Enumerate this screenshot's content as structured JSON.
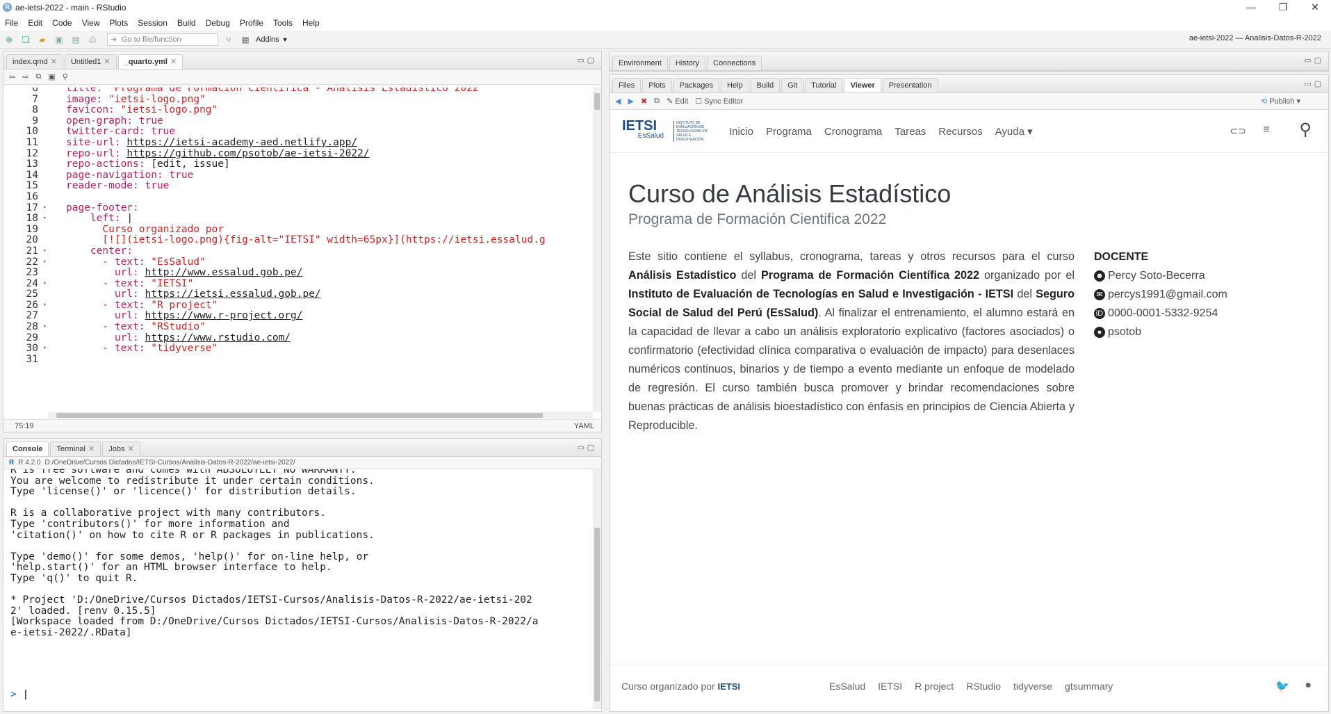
{
  "window": {
    "title": "ae-ietsi-2022 - main - RStudio",
    "app_icon": "R",
    "min": "—",
    "max": "❐",
    "close": "✕"
  },
  "menu": [
    "File",
    "Edit",
    "Code",
    "View",
    "Plots",
    "Session",
    "Build",
    "Debug",
    "Profile",
    "Tools",
    "Help"
  ],
  "toolbar": {
    "goto_placeholder": "Go to file/function",
    "addins": "Addins",
    "project": "ae-ietsi-2022 — Analisis-Datos-R-2022"
  },
  "editor": {
    "tabs": [
      {
        "label": "index.qmd",
        "active": false
      },
      {
        "label": "Untitled1",
        "active": false
      },
      {
        "label": "_quarto.yml",
        "active": true
      }
    ],
    "status_pos": "75:19",
    "status_mode": "YAML",
    "lines": [
      {
        "n": "6",
        "fold": false,
        "html": "<span class='k'>title: </span><span class='s'>\"Programa de Formación Cientifica - Análisis Estadístico 2022\"</span>"
      },
      {
        "n": "7",
        "fold": false,
        "html": "<span class='k'>image: </span><span class='s'>\"ietsi-logo.png\"</span>"
      },
      {
        "n": "8",
        "fold": false,
        "html": "<span class='k'>favicon: </span><span class='s'>\"ietsi-logo.png\"</span>"
      },
      {
        "n": "9",
        "fold": false,
        "html": "<span class='k'>open-graph: true</span>"
      },
      {
        "n": "10",
        "fold": false,
        "html": "<span class='k'>twitter-card: true</span>"
      },
      {
        "n": "11",
        "fold": false,
        "html": "<span class='k'>site-url: </span><span class='u'>https://ietsi-academy-aed.netlify.app/</span>"
      },
      {
        "n": "12",
        "fold": false,
        "html": "<span class='k'>repo-url: </span><span class='u'>https://github.com/psotob/ae-ietsi-2022/</span>"
      },
      {
        "n": "13",
        "fold": false,
        "html": "<span class='k'>repo-actions: </span><span class='p'>[edit, issue]</span>"
      },
      {
        "n": "14",
        "fold": false,
        "html": "<span class='k'>page-navigation: true</span>"
      },
      {
        "n": "15",
        "fold": false,
        "html": "<span class='k'>reader-mode: true</span>"
      },
      {
        "n": "16",
        "fold": false,
        "html": ""
      },
      {
        "n": "17",
        "fold": true,
        "html": "<span class='k'>page-footer:</span>"
      },
      {
        "n": "18",
        "fold": true,
        "html": "    <span class='k'>left: </span><span class='p'>|</span>"
      },
      {
        "n": "19",
        "fold": false,
        "html": "      <span class='st'>Curso organizado por</span>"
      },
      {
        "n": "20",
        "fold": false,
        "html": "      <span class='st'>[![](ietsi-logo.png){fig-alt=\"IETSI\" width=65px}](https://ietsi.essalud.g</span>"
      },
      {
        "n": "21",
        "fold": true,
        "html": "    <span class='k'>center:</span>"
      },
      {
        "n": "22",
        "fold": true,
        "html": "      <span class='k'>- text: </span><span class='s'>\"EsSalud\"</span>"
      },
      {
        "n": "23",
        "fold": false,
        "html": "        <span class='k'>url: </span><span class='u'>http://www.essalud.gob.pe/</span>"
      },
      {
        "n": "24",
        "fold": true,
        "html": "      <span class='k'>- text: </span><span class='s'>\"IETSI\"</span>"
      },
      {
        "n": "25",
        "fold": false,
        "html": "        <span class='k'>url: </span><span class='u'>https://ietsi.essalud.gob.pe/</span>"
      },
      {
        "n": "26",
        "fold": true,
        "html": "      <span class='k'>- text: </span><span class='s'>\"R project\"</span>"
      },
      {
        "n": "27",
        "fold": false,
        "html": "        <span class='k'>url: </span><span class='u'>https://www.r-project.org/</span>"
      },
      {
        "n": "28",
        "fold": true,
        "html": "      <span class='k'>- text: </span><span class='s'>\"RStudio\"</span>"
      },
      {
        "n": "29",
        "fold": false,
        "html": "        <span class='k'>url: </span><span class='u'>https://www.rstudio.com/</span>"
      },
      {
        "n": "30",
        "fold": true,
        "html": "      <span class='k'>- text: </span><span class='s'>\"tidyverse\"</span>"
      },
      {
        "n": "31",
        "fold": false,
        "html": ""
      }
    ]
  },
  "console": {
    "tabs": [
      {
        "label": "Console",
        "active": true
      },
      {
        "label": "Terminal",
        "active": false
      },
      {
        "label": "Jobs",
        "active": false
      }
    ],
    "r_version": "R 4.2.0",
    "path": "D:/OneDrive/Cursos Dictados/IETSI-Cursos/Analisis-Datos-R-2022/ae-ietsi-2022/",
    "output": "R is free software and comes with ABSOLUTELY NO WARRANTY.\nYou are welcome to redistribute it under certain conditions.\nType 'license()' or 'licence()' for distribution details.\n\nR is a collaborative project with many contributors.\nType 'contributors()' for more information and\n'citation()' on how to cite R or R packages in publications.\n\nType 'demo()' for some demos, 'help()' for on-line help, or\n'help.start()' for an HTML browser interface to help.\nType 'q()' to quit R.\n\n* Project 'D:/OneDrive/Cursos Dictados/IETSI-Cursos/Analisis-Datos-R-2022/ae-ietsi-202\n2' loaded. [renv 0.15.5]\n[Workspace loaded from D:/OneDrive/Cursos Dictados/IETSI-Cursos/Analisis-Datos-R-2022/a\ne-ietsi-2022/.RData]",
    "prompt": ">"
  },
  "env_pane": {
    "tabs": [
      {
        "label": "Environment",
        "active": false
      },
      {
        "label": "History",
        "active": false
      },
      {
        "label": "Connections",
        "active": false
      }
    ]
  },
  "viewer_pane": {
    "tabs": [
      {
        "label": "Files",
        "active": false
      },
      {
        "label": "Plots",
        "active": false
      },
      {
        "label": "Packages",
        "active": false
      },
      {
        "label": "Help",
        "active": false
      },
      {
        "label": "Build",
        "active": false
      },
      {
        "label": "Git",
        "active": false
      },
      {
        "label": "Tutorial",
        "active": false
      },
      {
        "label": "Viewer",
        "active": true
      },
      {
        "label": "Presentation",
        "active": false
      }
    ],
    "edit_label": "Edit",
    "sync_label": "Sync Editor",
    "publish_label": "Publish"
  },
  "site": {
    "logo_text": "IETSI",
    "logo_sub": "EsSalud",
    "logo_small": "INSTITUTO DE EVALUACIÓN DE TECNOLOGÍAS EN SALUD E INVESTIGACIÓN",
    "nav": [
      "Inicio",
      "Programa",
      "Cronograma",
      "Tareas",
      "Recursos",
      "Ayuda"
    ],
    "title": "Curso de Análisis Estadístico",
    "subtitle": "Programa de Formación Cientifica 2022",
    "body": [
      {
        "t": "Este sitio contiene el syllabus, cronograma, tareas y otros recursos para el curso ",
        "b": false
      },
      {
        "t": "Análisis Estadístico",
        "b": true
      },
      {
        "t": " del ",
        "b": false
      },
      {
        "t": "Programa de Formación Científica 2022",
        "b": true
      },
      {
        "t": " organizado por el ",
        "b": false
      },
      {
        "t": "Instituto de Evaluación de Tecnologías en Salud e Investigación - IETSI",
        "b": true
      },
      {
        "t": " del ",
        "b": false
      },
      {
        "t": "Seguro Social de Salud del Perú (EsSalud)",
        "b": true
      },
      {
        "t": ". Al finalizar el entrenamiento, el alumno estará en la capacidad de llevar a cabo un análisis exploratorio explicativo (factores asociados) o confirmatorio (efectividad clínica comparativa o evaluación de impacto) para desenlaces numéricos continuos, binarios y de tiempo a evento mediante un enfoque de modelado de regresión. El curso también busca promover y brindar recomendaciones sobre buenas prácticas de análisis bioestadístico con énfasis en principios de Ciencia Abierta y Reproducible.",
        "b": false
      }
    ],
    "docente_heading": "DOCENTE",
    "docente": [
      {
        "icon": "smiley-icon",
        "glyph": "☻",
        "text": "Percy Soto-Becerra"
      },
      {
        "icon": "email-icon",
        "glyph": "✉",
        "text": "percys1991@gmail.com"
      },
      {
        "icon": "orcid-icon",
        "glyph": "iD",
        "text": "0000-0001-5332-9254"
      },
      {
        "icon": "github-icon",
        "glyph": "●",
        "text": "psotob"
      }
    ],
    "footer_left": "Curso organizado por",
    "footer_links": [
      "EsSalud",
      "IETSI",
      "R project",
      "RStudio",
      "tidyverse",
      "gtsummary"
    ]
  }
}
